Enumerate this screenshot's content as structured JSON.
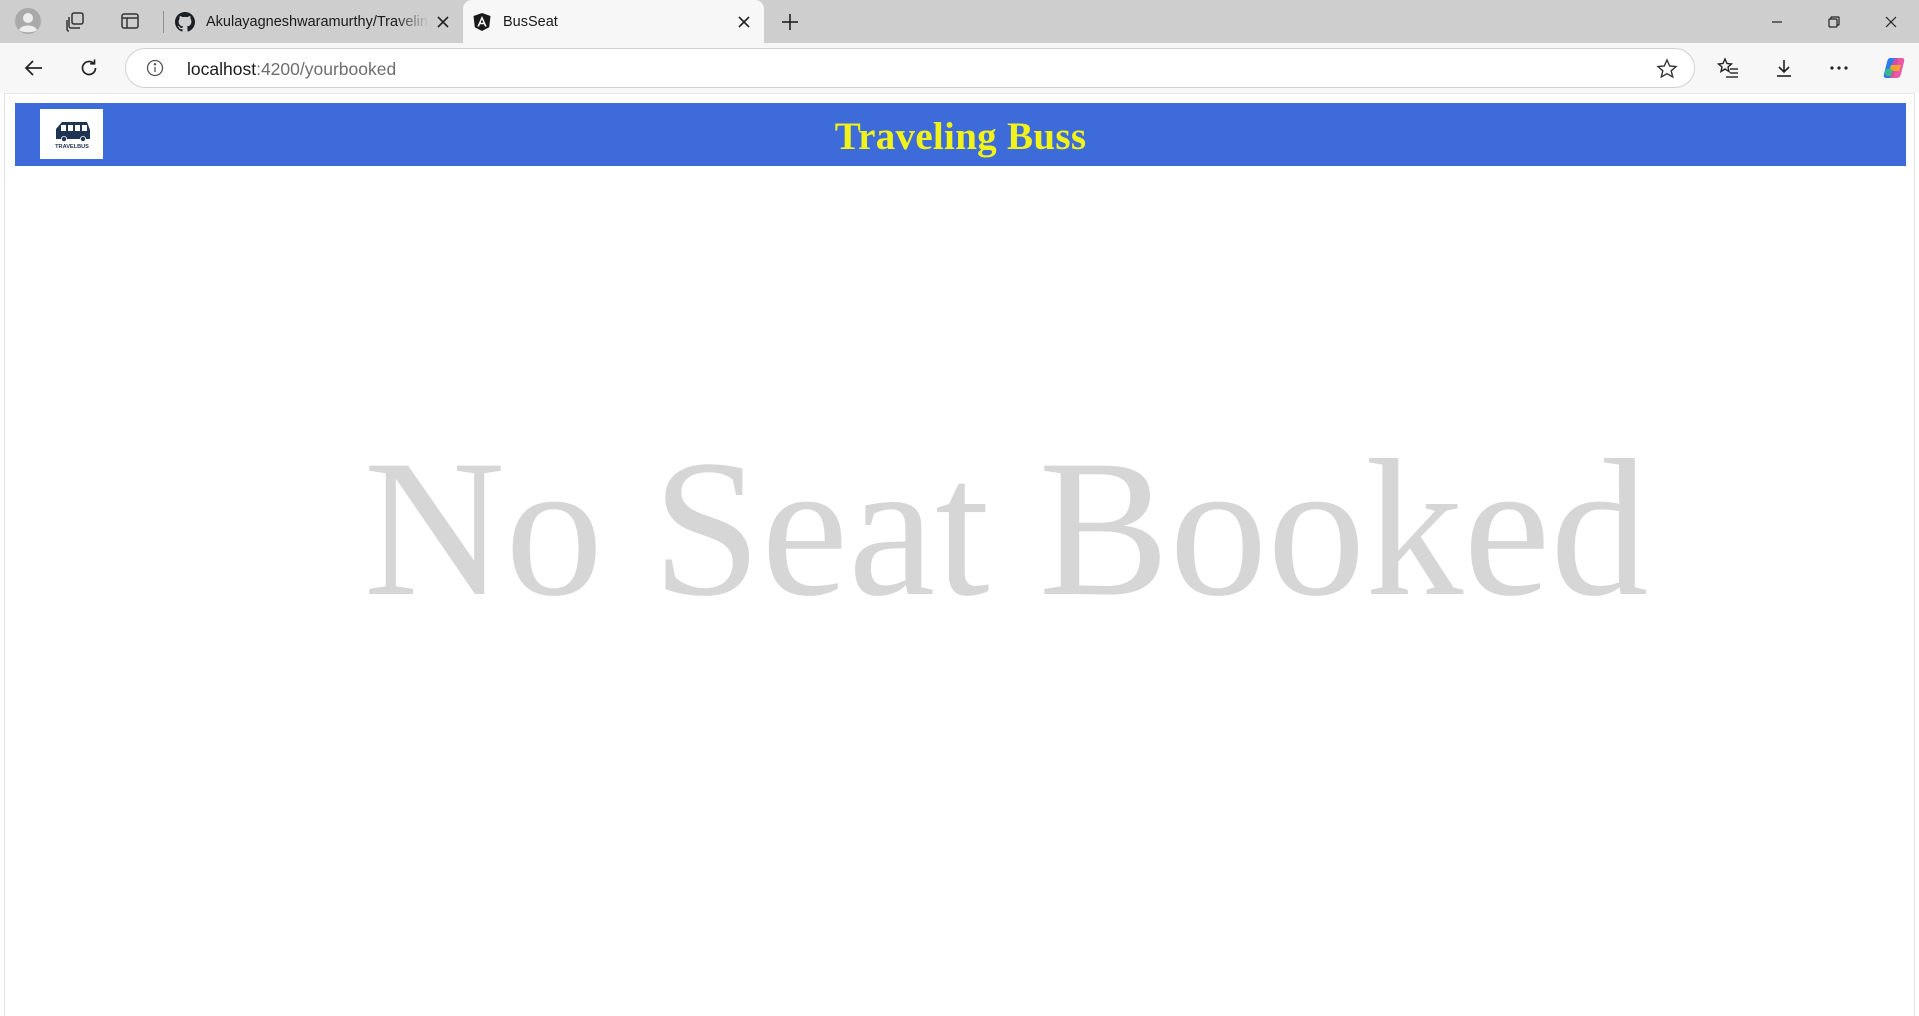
{
  "browser": {
    "tabs": [
      {
        "title": "Akulayagneshwaramurthy/Traveling",
        "favicon": "github-icon",
        "active": false
      },
      {
        "title": "BusSeat",
        "favicon": "angular-icon",
        "active": true
      }
    ],
    "address": {
      "host": "localhost",
      "path": ":4200/yourbooked"
    }
  },
  "app": {
    "brand_title": "Traveling Buss",
    "logo_text": "TRAVELBUS",
    "header_color": "#3d6bd9",
    "brand_color": "#f2f21b"
  },
  "main": {
    "empty_message": "No Seat Booked"
  }
}
